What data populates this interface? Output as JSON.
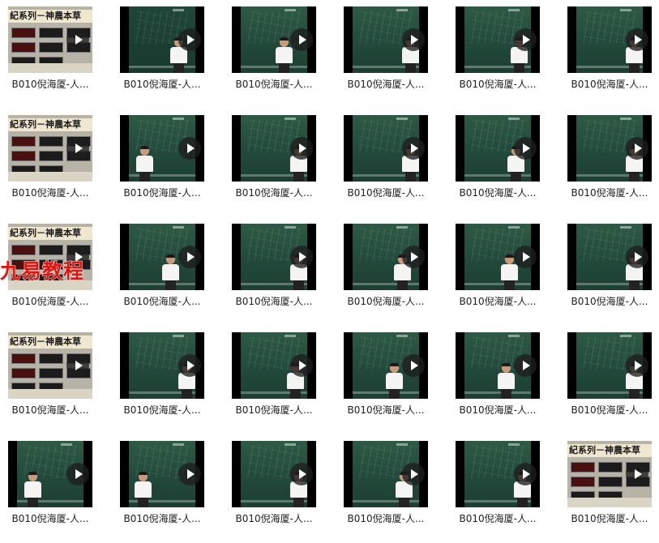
{
  "watermark": "九易教程",
  "title_card_text": "紀系列－神農本草",
  "files": [
    {
      "label": "B010倪海厦-人...",
      "thumb": "title-card"
    },
    {
      "label": "B010倪海厦-人...",
      "thumb": "lecture-dark"
    },
    {
      "label": "B010倪海厦-人...",
      "thumb": "lecture"
    },
    {
      "label": "B010倪海厦-人...",
      "thumb": "lecture"
    },
    {
      "label": "B010倪海厦-人...",
      "thumb": "lecture"
    },
    {
      "label": "B010倪海厦-人...",
      "thumb": "lecture"
    },
    {
      "label": "B010倪海厦-人...",
      "thumb": "title-card"
    },
    {
      "label": "B010倪海厦-人...",
      "thumb": "lecture"
    },
    {
      "label": "B010倪海厦-人...",
      "thumb": "lecture"
    },
    {
      "label": "B010倪海厦-人...",
      "thumb": "lecture"
    },
    {
      "label": "B010倪海厦-人...",
      "thumb": "lecture"
    },
    {
      "label": "B010倪海厦-人...",
      "thumb": "lecture"
    },
    {
      "label": "B010倪海厦-人...",
      "thumb": "title-card"
    },
    {
      "label": "B010倪海厦-人...",
      "thumb": "lecture"
    },
    {
      "label": "B010倪海厦-人...",
      "thumb": "lecture"
    },
    {
      "label": "B010倪海厦-人...",
      "thumb": "lecture"
    },
    {
      "label": "B010倪海厦-人...",
      "thumb": "lecture"
    },
    {
      "label": "B010倪海厦-人...",
      "thumb": "lecture"
    },
    {
      "label": "B010倪海厦-人...",
      "thumb": "title-card"
    },
    {
      "label": "B010倪海厦-人...",
      "thumb": "lecture"
    },
    {
      "label": "B010倪海厦-人...",
      "thumb": "lecture"
    },
    {
      "label": "B010倪海厦-人...",
      "thumb": "lecture"
    },
    {
      "label": "B010倪海厦-人...",
      "thumb": "lecture"
    },
    {
      "label": "B010倪海厦-人...",
      "thumb": "lecture"
    },
    {
      "label": "B010倪海厦-人...",
      "thumb": "lecture"
    },
    {
      "label": "B010倪海厦-人...",
      "thumb": "lecture"
    },
    {
      "label": "B010倪海厦-人...",
      "thumb": "lecture"
    },
    {
      "label": "B010倪海厦-人...",
      "thumb": "lecture"
    },
    {
      "label": "B010倪海厦-人...",
      "thumb": "lecture"
    },
    {
      "label": "B010倪海厦-人...",
      "thumb": "title-card"
    }
  ],
  "colors": {
    "chalkboard": "#2e5a45",
    "watermark": "#e3140e",
    "label_text": "#222222"
  },
  "icons": {
    "play_overlay": "play-icon"
  }
}
